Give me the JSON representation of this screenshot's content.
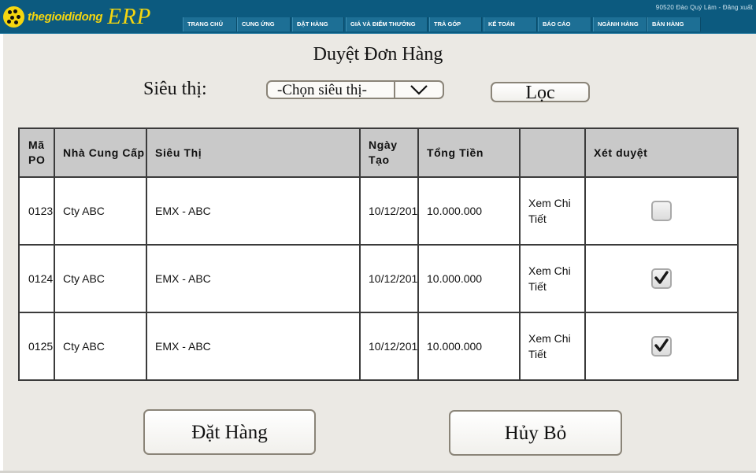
{
  "header": {
    "brand": "thegioididong",
    "app_name": "ERP",
    "user_info": "90520 Đào Quý Lâm - Đăng xuất",
    "nav": [
      {
        "label": "TRANG CHỦ"
      },
      {
        "label": "CUNG ỨNG"
      },
      {
        "label": "ĐẶT HÀNG"
      },
      {
        "label": "GIÁ VÀ ĐIỂM THƯỞNG"
      },
      {
        "label": "TRẢ GÓP"
      },
      {
        "label": "KẾ TOÁN"
      },
      {
        "label": "BÁO CÁO"
      },
      {
        "label": "NGÀNH HÀNG"
      },
      {
        "label": "BÁN HÀNG"
      }
    ]
  },
  "page": {
    "title": "Duyệt Đơn Hàng",
    "filter_label": "Siêu thị:",
    "select_value": "-Chọn siêu thị-",
    "filter_button": "Lọc"
  },
  "table": {
    "headers": {
      "po": "Mã PO",
      "supplier": "Nhà Cung Cấp",
      "store": "Siêu Thị",
      "date": "Ngày Tạo",
      "total": "Tổng Tiền",
      "detail": "",
      "approve": "Xét duyệt"
    },
    "rows": [
      {
        "po": "0123",
        "supplier": "Cty ABC",
        "store": "EMX - ABC",
        "date": "10/12/201",
        "total": "10.000.000",
        "detail": "Xem Chi Tiết",
        "approved": false
      },
      {
        "po": "0124",
        "supplier": "Cty ABC",
        "store": "EMX - ABC",
        "date": "10/12/201",
        "total": "10.000.000",
        "detail": "Xem Chi Tiết",
        "approved": true
      },
      {
        "po": "0125",
        "supplier": "Cty ABC",
        "store": "EMX - ABC",
        "date": "10/12/201",
        "total": "10.000.000",
        "detail": "Xem Chi Tiết",
        "approved": true
      }
    ]
  },
  "actions": {
    "order_button": "Đặt Hàng",
    "cancel_button": "Hủy Bỏ"
  },
  "colors": {
    "brand_yellow": "#f5d60f",
    "header_blue": "#0c5a7f",
    "content_bg": "#ebe9e4",
    "table_header_bg": "#c9c9c9"
  },
  "icons": {
    "logo": "thegioididong-logo-icon",
    "dropdown": "chevron-down-icon",
    "check": "checkmark-icon"
  }
}
